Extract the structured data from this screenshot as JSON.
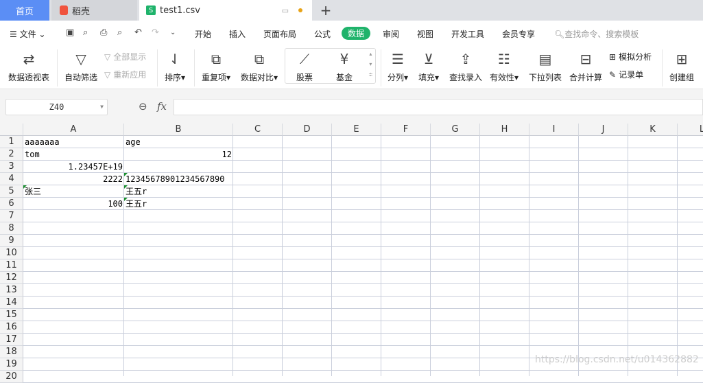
{
  "tabs": [
    {
      "label": "首页",
      "active": false
    },
    {
      "label": "稻壳",
      "active": false
    },
    {
      "label": "test1.csv",
      "active": true,
      "unsaved": true
    }
  ],
  "menu": {
    "file": "文件",
    "items": [
      "开始",
      "插入",
      "页面布局",
      "公式",
      "数据",
      "审阅",
      "视图",
      "开发工具",
      "会员专享"
    ],
    "active": "数据",
    "search_placeholder": "查找命令、搜索模板"
  },
  "ribbon": {
    "pivot": "数据透视表",
    "autofilter": "自动筛选",
    "show_all": "全部显示",
    "reapply": "重新应用",
    "sort": "排序",
    "dup": "重复项",
    "compare": "数据对比",
    "stock": "股票",
    "fund": "基金",
    "split": "分列",
    "fill": "填充",
    "lookup": "查找录入",
    "validity": "有效性",
    "dropdown": "下拉列表",
    "consolidate": "合并计算",
    "whatif": "模拟分析",
    "record": "记录单",
    "group": "创建组"
  },
  "formula_bar": {
    "name_box": "Z40",
    "fx": "fx",
    "value": ""
  },
  "columns": [
    "A",
    "B",
    "C",
    "D",
    "E",
    "F",
    "G",
    "H",
    "I",
    "J",
    "K",
    "L"
  ],
  "rows": [
    "1",
    "2",
    "3",
    "4",
    "5",
    "6",
    "7",
    "8",
    "9",
    "10",
    "11",
    "12",
    "13",
    "14",
    "15",
    "16",
    "17",
    "18",
    "19",
    "20"
  ],
  "cells": {
    "A1": "aaaaaaa",
    "B1": "age",
    "A2": "tom",
    "B2": "12",
    "A3": "1.23457E+19",
    "A4": "2222",
    "B4": "12345678901234567890",
    "A5": "张三",
    "B5": "王五r",
    "A6": "100",
    "B6": "王五r"
  },
  "watermark": "https://blog.csdn.net/u014362882",
  "colors": {
    "accent": "#1fb36b",
    "home_tab": "#5b8ef5",
    "grid": "#c9cedb"
  }
}
